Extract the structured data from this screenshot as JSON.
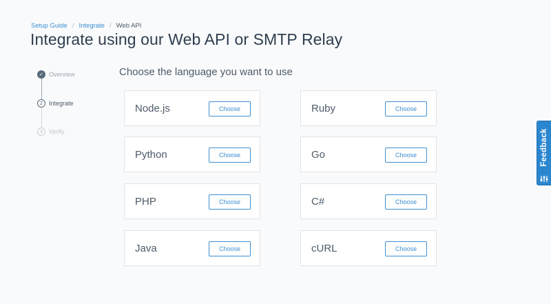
{
  "breadcrumb": {
    "items": [
      "Setup Guide",
      "Integrate",
      "Web API"
    ],
    "separator": "/"
  },
  "page": {
    "title": "Integrate using our Web API or SMTP Relay"
  },
  "stepper": {
    "steps": [
      {
        "marker": "✓",
        "label": "Overview",
        "state": "done"
      },
      {
        "marker": "2",
        "label": "Integrate",
        "state": "current"
      },
      {
        "marker": "3",
        "label": "Verify",
        "state": "todo"
      }
    ]
  },
  "main": {
    "heading": "Choose the language you want to use",
    "choose_label": "Choose",
    "languages": [
      {
        "name": "Node.js"
      },
      {
        "name": "Ruby"
      },
      {
        "name": "Python"
      },
      {
        "name": "Go"
      },
      {
        "name": "PHP"
      },
      {
        "name": "C#"
      },
      {
        "name": "Java"
      },
      {
        "name": "cURL"
      }
    ]
  },
  "feedback": {
    "label": "Feedback",
    "icon": "sliders-icon"
  },
  "colors": {
    "accent": "#3d8fd1",
    "feedback_tab": "#2a86cf",
    "background": "#f9fafb",
    "title_text": "#2e3e4e"
  }
}
